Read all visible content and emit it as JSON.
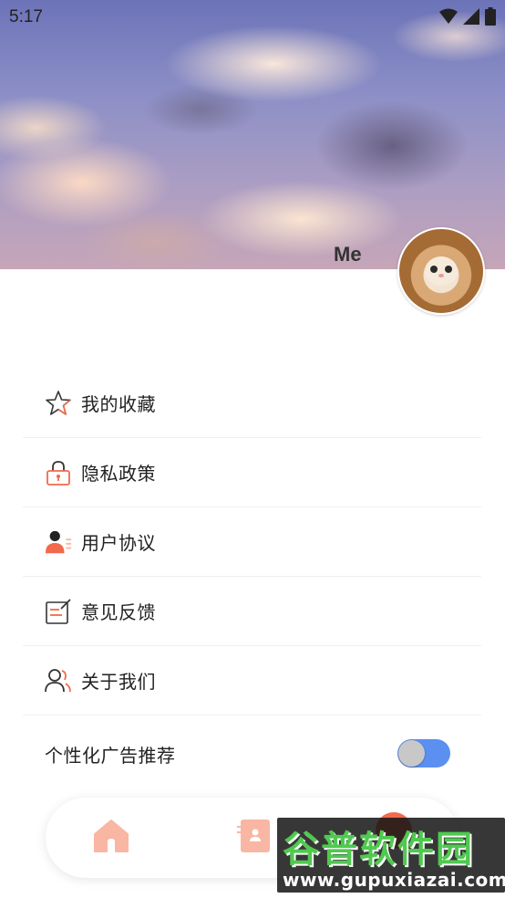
{
  "status_bar": {
    "time": "5:17",
    "icons": [
      "wifi-icon",
      "signal-icon",
      "battery-icon"
    ]
  },
  "profile": {
    "name": "Me",
    "avatar": "kitten-in-lion-hat-avatar"
  },
  "menu": {
    "items": [
      {
        "label": "我的收藏",
        "icon": "star-icon"
      },
      {
        "label": "隐私政策",
        "icon": "lock-icon"
      },
      {
        "label": "用户协议",
        "icon": "user-agreement-icon"
      },
      {
        "label": "意见反馈",
        "icon": "feedback-edit-icon"
      },
      {
        "label": "关于我们",
        "icon": "users-icon"
      }
    ],
    "toggle": {
      "label": "个性化广告推荐",
      "on": true
    }
  },
  "bottom_nav": {
    "items": [
      {
        "icon": "home-icon"
      },
      {
        "icon": "contacts-icon"
      },
      {
        "icon": "profile-icon"
      }
    ]
  },
  "watermark": {
    "title": "谷普软件园",
    "url": "www.gupuxiazai.com"
  },
  "colors": {
    "accent": "#f26a4b",
    "accent_light": "#f8b6a3",
    "toggle_on": "#5b8ff0",
    "text": "#222222"
  }
}
